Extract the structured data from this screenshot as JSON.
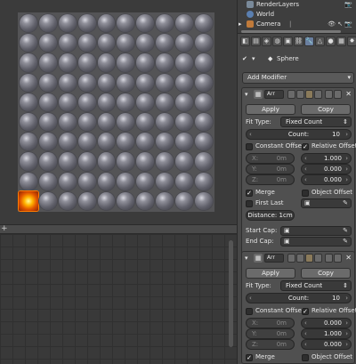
{
  "outliner": {
    "rows": [
      {
        "label": "RenderLayers",
        "icon": "render-layers-icon"
      },
      {
        "label": "World",
        "icon": "world-icon"
      },
      {
        "label": "Camera",
        "icon": "camera-icon"
      }
    ]
  },
  "properties": {
    "object_name": "Sphere",
    "add_modifier": "Add Modifier",
    "modifiers": [
      {
        "name": "Arr",
        "apply": "Apply",
        "copy": "Copy",
        "fit_type_label": "Fit Type:",
        "fit_type_value": "Fixed Count",
        "count_label": "Count:",
        "count_value": "10",
        "constant_offset": "Constant Offset",
        "relative_offset": "Relative Offset",
        "x_label": "X:",
        "y_label": "Y:",
        "z_label": "Z:",
        "const_x": "0m",
        "const_y": "0m",
        "const_z": "0m",
        "rel_x": "1.000",
        "rel_y": "0.000",
        "rel_z": "0.000",
        "merge": "Merge",
        "object_offset": "Object Offset",
        "first_last": "First Last",
        "distance_label": "Distance:",
        "distance_value": "1cm",
        "start_cap": "Start Cap:",
        "end_cap": "End Cap:"
      },
      {
        "name": "Arr",
        "apply": "Apply",
        "copy": "Copy",
        "fit_type_label": "Fit Type:",
        "fit_type_value": "Fixed Count",
        "count_label": "Count:",
        "count_value": "10",
        "constant_offset": "Constant Offset",
        "relative_offset": "Relative Offset",
        "x_label": "X:",
        "y_label": "Y:",
        "z_label": "Z:",
        "const_x": "0m",
        "const_y": "0m",
        "const_z": "0m",
        "rel_x": "0.000",
        "rel_y": "1.000",
        "rel_z": "0.000",
        "merge": "Merge",
        "object_offset": "Object Offset"
      }
    ]
  },
  "colors": {
    "selection": "#ff7a00",
    "active_tab": "#6a7fa0"
  }
}
